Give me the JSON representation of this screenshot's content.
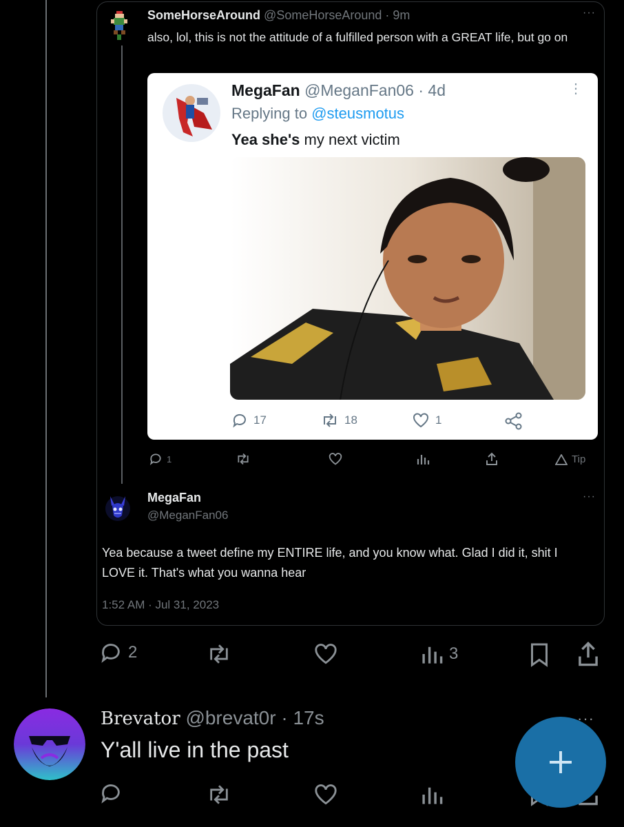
{
  "colors": {
    "accent": "#1d9bf0",
    "fab": "#1a6fa6",
    "muted": "#71767b",
    "background": "#000000"
  },
  "quoted_tweet": {
    "display_name": "SomeHorseAround",
    "handle": "@SomeHorseAround",
    "time": "· 9m",
    "text": "also, lol, this is not the attitude of a fulfilled person with a GREAT life, but go on",
    "more": "···",
    "screenshot": {
      "display_name": "MegaFan",
      "handle": "@MeganFan06",
      "time": "· 4d",
      "replying_prefix": "Replying to",
      "replying_to": "@steusmotus",
      "text_bold": "Yea she's",
      "text_rest": " my next victim",
      "actions": {
        "replies": "17",
        "retweets": "18",
        "likes": "1"
      }
    },
    "actions": {
      "replies": "1",
      "tip": "Tip"
    }
  },
  "reply_tweet": {
    "display_name": "MegaFan",
    "handle": "@MeganFan06",
    "more": "···",
    "text": "Yea because a tweet define my ENTIRE life, and you know what. Glad I did it, shit I LOVE it. That's what you wanna hear",
    "timestamp": "1:52 AM · Jul 31, 2023"
  },
  "main_actions": {
    "replies": "2",
    "views": "3"
  },
  "reply": {
    "display_name": "Brevator",
    "handle": "@brevat0r",
    "time": "· 17s",
    "text": "Y'all live in the past",
    "more": "···"
  },
  "icons": [
    "reply-icon",
    "retweet-icon",
    "like-icon",
    "views-icon",
    "bookmark-icon",
    "share-icon",
    "compose-plus-icon",
    "tip-icon"
  ]
}
